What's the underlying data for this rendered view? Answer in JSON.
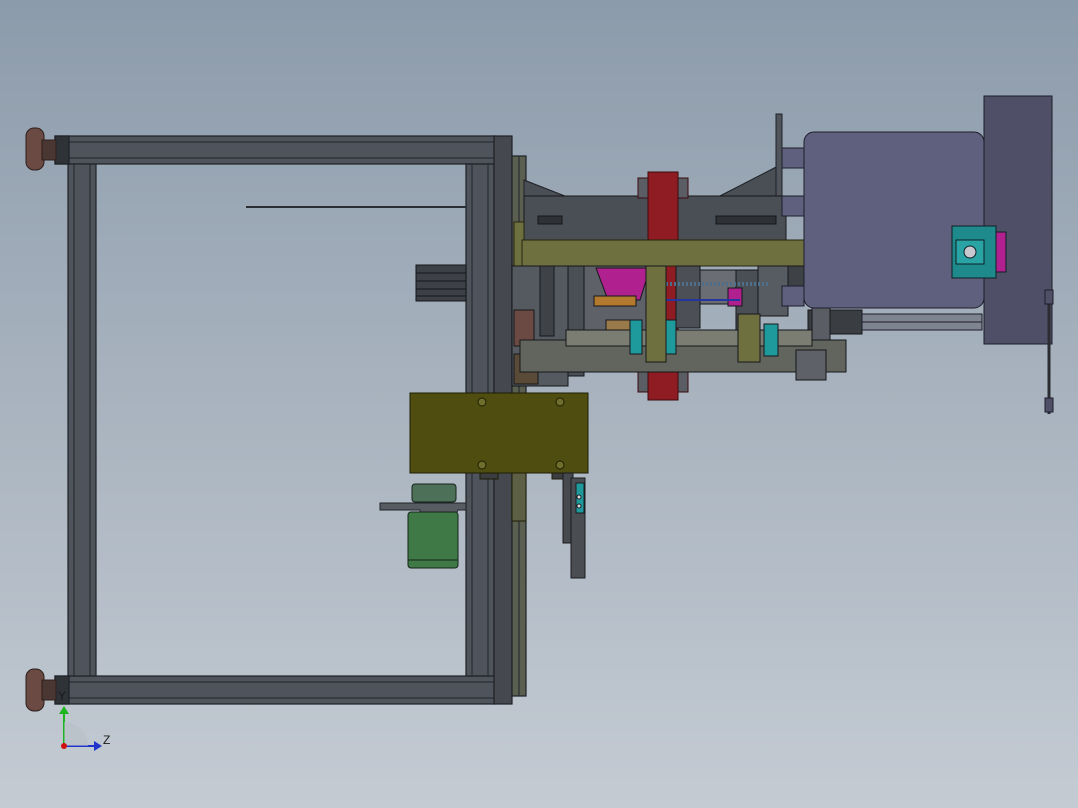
{
  "view": {
    "background_top": "#8c9bab",
    "background_bottom": "#c4cbd3"
  },
  "triad": {
    "y_label": "Y",
    "z_label": "Z",
    "y_color": "#1fb51f",
    "z_color": "#2233cc",
    "origin_color": "#d01010"
  },
  "colors": {
    "frame": "#4e535c",
    "frame_edge": "#1e2126",
    "frame_inner": "#5b6069",
    "foot": "#6a4a42",
    "motor_housing": "#5f5f7e",
    "motor_cap": "#4f5068",
    "olive_bar": "#6e7040",
    "olive_box": "#4f4e10",
    "red_plate": "#8e1c22",
    "teal": "#1f9a9c",
    "magenta": "#b0208f",
    "green_motor": "#3f7a46",
    "shaft": "#62645e"
  }
}
